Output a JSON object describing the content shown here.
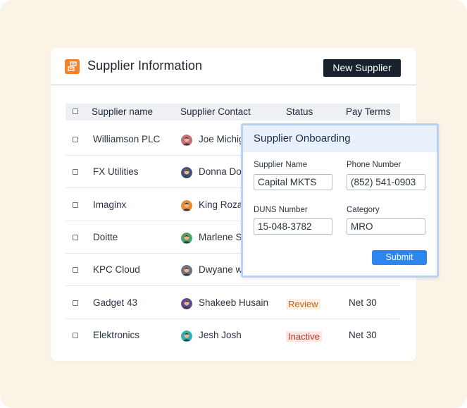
{
  "header": {
    "title": "Supplier Information",
    "new_button_label": "New Supplier"
  },
  "table": {
    "columns": [
      "Supplier name",
      "Supplier Contact",
      "Status",
      "Pay Terms"
    ],
    "rows": [
      {
        "name": "Williamson PLC",
        "contact": "Joe Michig",
        "status": "",
        "pay_terms": "",
        "avatar_color": "#c56b7a"
      },
      {
        "name": "FX Utilities",
        "contact": "Donna Doe",
        "status": "",
        "pay_terms": "",
        "avatar_color": "#3d4f7a"
      },
      {
        "name": "Imaginx",
        "contact": "King Rozau",
        "status": "",
        "pay_terms": "",
        "avatar_color": "#e38a2b"
      },
      {
        "name": "Doitte",
        "contact": "Marlene Sc",
        "status": "",
        "pay_terms": "",
        "avatar_color": "#4aa564"
      },
      {
        "name": "KPC Cloud",
        "contact": "Dwyane w",
        "status": "",
        "pay_terms": "",
        "avatar_color": "#6b7280"
      },
      {
        "name": "Gadget 43",
        "contact": "Shakeeb Husain",
        "status": "Review",
        "pay_terms": "Net 30",
        "avatar_color": "#5b4a8a"
      },
      {
        "name": "Elektronics",
        "contact": "Jesh Josh",
        "status": "Inactive",
        "pay_terms": "Net 30",
        "avatar_color": "#2bb0b5"
      }
    ]
  },
  "modal": {
    "title": "Supplier Onboarding",
    "fields": {
      "supplier_name": {
        "label": "Supplier Name",
        "value": "Capital MKTS"
      },
      "phone_number": {
        "label": "Phone Number",
        "value": "(852) 541-0903"
      },
      "duns_number": {
        "label": "DUNS Number",
        "value": "15-048-3782"
      },
      "category": {
        "label": "Category",
        "value": "MRO"
      }
    },
    "submit_label": "Submit"
  },
  "colors": {
    "backdrop": "#fbf3e6",
    "accent_orange": "#f4822a",
    "primary_dark": "#18222e",
    "submit_blue": "#2d86f0",
    "review": "#c2640f",
    "inactive": "#c2331f"
  },
  "icons": {
    "app": "supplier-app-icon",
    "checkbox": "checkbox-icon"
  }
}
